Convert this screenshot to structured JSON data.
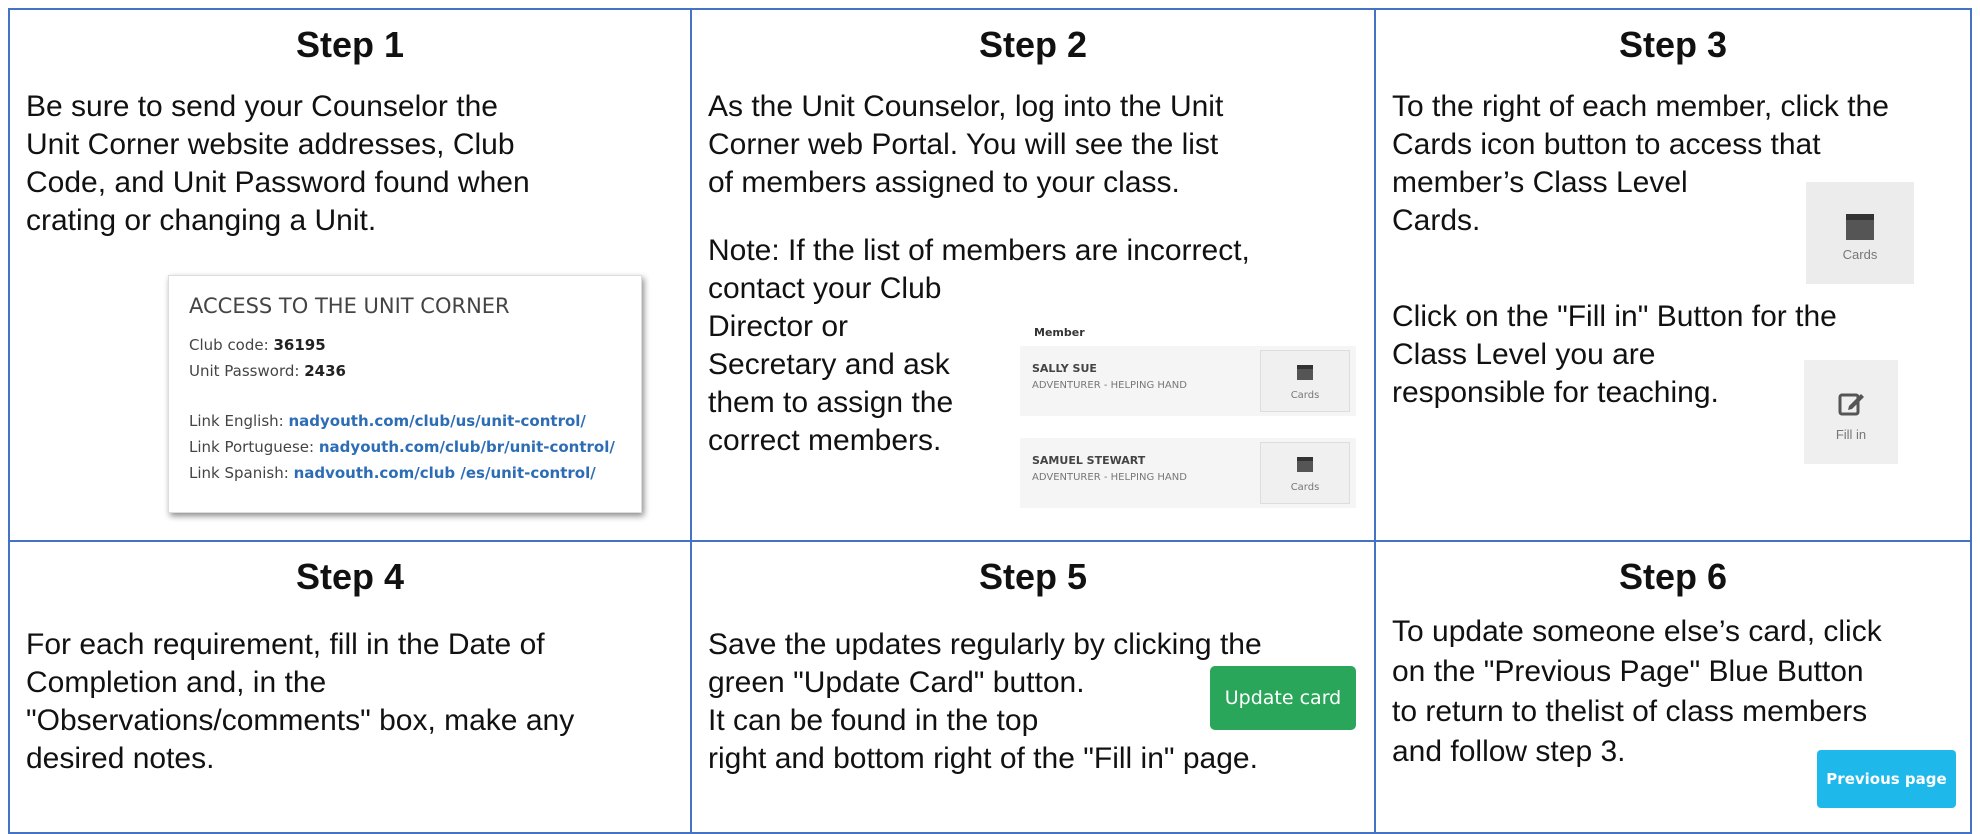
{
  "steps": [
    {
      "title": "Step 1",
      "lines": [
        "Be sure to send your Counselor the",
        "Unit Corner website addresses, Club",
        "Code, and Unit Password found when",
        "crating or changing a Unit."
      ]
    },
    {
      "title": "Step 2",
      "lines": [
        "As the Unit Counselor, log into the Unit",
        "Corner web Portal. You will see the list",
        "of members assigned to your class."
      ],
      "note_line": "Note: If the list of members are incorrect,",
      "note_lines": [
        "contact your Club",
        "Director or",
        "Secretary and ask",
        "them to assign the",
        "correct members."
      ]
    },
    {
      "title": "Step 3",
      "lines": [
        "To the right of each member, click the",
        "Cards icon button to access that",
        "member’s Class Level",
        "Cards."
      ],
      "lines2": [
        "Click on the \"Fill in\" Button for the",
        "Class Level you are",
        "responsible for teaching."
      ]
    },
    {
      "title": "Step 4",
      "lines": [
        "For each requirement, fill in the Date of",
        "Completion and, in the",
        "\"Observations/comments\" box, make any",
        "desired notes."
      ]
    },
    {
      "title": "Step 5",
      "lines": [
        "Save the updates regularly by clicking the",
        "green \"Update Card\" button.",
        "It can be found in the top",
        "right and bottom right of the \"Fill in\" page."
      ]
    },
    {
      "title": "Step 6",
      "lines": [
        "To update someone else’s card, click",
        "on the \"Previous Page\" Blue Button",
        "to return to thelist of class members",
        "and follow step 3."
      ]
    }
  ],
  "access_box": {
    "heading": "ACCESS TO THE UNIT CORNER",
    "club_code_label": "Club code:",
    "club_code": "36195",
    "password_label": "Unit Password:",
    "password": "2436",
    "links": [
      {
        "label": "Link English:",
        "url": "nadyouth.com/club/us/unit-control/"
      },
      {
        "label": "Link Portuguese:",
        "url": "nadyouth.com/club/br/unit-control/"
      },
      {
        "label": "Link Spanish:",
        "url": "nadvouth.com/club /es/unit-control/"
      }
    ]
  },
  "member_list": {
    "header": "Member",
    "members": [
      {
        "name": "SALLY SUE",
        "class": "ADVENTURER - HELPING HAND",
        "button": "Cards"
      },
      {
        "name": "SAMUEL STEWART",
        "class": "ADVENTURER - HELPING HAND",
        "button": "Cards"
      }
    ]
  },
  "buttons": {
    "cards": "Cards",
    "fill_in": "Fill in",
    "update_card": "Update card",
    "previous_page": "Previous page"
  },
  "colors": {
    "border": "#4472c4",
    "update_green": "#2aa65a",
    "previous_blue": "#1fb8ea"
  }
}
